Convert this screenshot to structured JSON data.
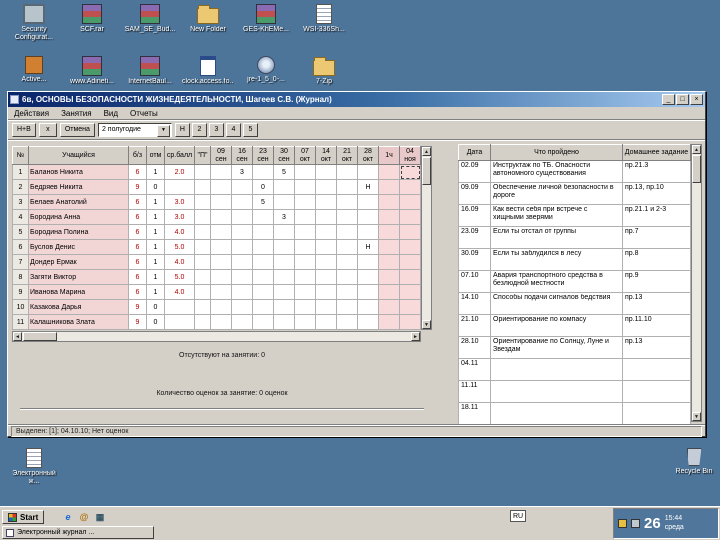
{
  "desktop": {
    "bg_color": "#4d7499",
    "icons_row1": [
      {
        "label": "Security Configurat...",
        "type": "app"
      },
      {
        "label": "SCF.rar",
        "type": "rar"
      },
      {
        "label": "SAM_SE_Bud...",
        "type": "rar"
      },
      {
        "label": "New Folder",
        "type": "folder"
      },
      {
        "label": "GES-KhEMe...",
        "type": "rar"
      },
      {
        "label": "WSI-336Sh...",
        "type": "doc"
      }
    ],
    "icons_row2": [
      {
        "label": "Active...",
        "type": "app2"
      },
      {
        "label": "www.Adineti...",
        "type": "rar"
      },
      {
        "label": "InternetBaul...",
        "type": "rar"
      },
      {
        "label": "clock.access.fo...",
        "type": "doc2"
      },
      {
        "label": "jre-1_5_0-...",
        "type": "installer"
      },
      {
        "label": "7-Zip",
        "type": "folder"
      }
    ],
    "bottom_icons": [
      {
        "label": "Электронный ж...",
        "type": "doc"
      },
      {
        "label": "Recycle Bin",
        "type": "recycle"
      }
    ]
  },
  "window": {
    "title": "6в, ОСНОВЫ БЕЗОПАСНОСТИ ЖИЗНЕДЕЯТЕЛЬНОСТИ, Шагеев С.В. (Журнал)",
    "menu": [
      "Действия",
      "Занятия",
      "Вид",
      "Отчеты"
    ],
    "toolbar": {
      "nv_button": "Н+В",
      "x_button": "х",
      "cancel_button": "Отмена",
      "period_select": "2 полугодие",
      "grade_buttons": [
        "Н",
        "2",
        "3",
        "4",
        "5"
      ]
    },
    "journal": {
      "col_headers": [
        "№",
        "Учащийся",
        "б/з",
        "отм",
        "ср.балл",
        "\"П\""
      ],
      "date_columns": [
        {
          "top": "09",
          "bot": "сен"
        },
        {
          "top": "16",
          "bot": "сен"
        },
        {
          "top": "23",
          "bot": "сен"
        },
        {
          "top": "30",
          "bot": "сен"
        },
        {
          "top": "07",
          "bot": "окт"
        },
        {
          "top": "14",
          "bot": "окт"
        },
        {
          "top": "21",
          "bot": "окт"
        },
        {
          "top": "28",
          "bot": "окт"
        },
        {
          "top": "1ч",
          "bot": ""
        },
        {
          "top": "04",
          "bot": "ноя"
        }
      ],
      "students": [
        {
          "num": "1",
          "name": "Баланов Никита",
          "bz": "6",
          "otm": "1",
          "avg": "2.0",
          "grades": [
            "",
            "3",
            "",
            "5",
            "",
            "",
            "",
            "",
            "",
            ""
          ]
        },
        {
          "num": "2",
          "name": "Бедряев Никита",
          "bz": "9",
          "otm": "0",
          "avg": "",
          "grades": [
            "",
            "",
            "0",
            "",
            "",
            "",
            "",
            "Н",
            "",
            ""
          ]
        },
        {
          "num": "3",
          "name": "Белаев Анатолий",
          "bz": "6",
          "otm": "1",
          "avg": "3.0",
          "grades": [
            "",
            "",
            "5",
            "",
            "",
            "",
            "",
            "",
            "",
            ""
          ]
        },
        {
          "num": "4",
          "name": "Бородина Анна",
          "bz": "6",
          "otm": "1",
          "avg": "3.0",
          "grades": [
            "",
            "",
            "",
            "3",
            "",
            "",
            "",
            "",
            "",
            ""
          ]
        },
        {
          "num": "5",
          "name": "Бородина Полина",
          "bz": "6",
          "otm": "1",
          "avg": "4.0",
          "grades": [
            "",
            "",
            "",
            "",
            "",
            "",
            "",
            "",
            "",
            ""
          ]
        },
        {
          "num": "6",
          "name": "Буслов Денис",
          "bz": "6",
          "otm": "1",
          "avg": "5.0",
          "grades": [
            "",
            "",
            "",
            "",
            "",
            "",
            "",
            "Н",
            "",
            ""
          ]
        },
        {
          "num": "7",
          "name": "Дондер Ермак",
          "bz": "6",
          "otm": "1",
          "avg": "4.0",
          "grades": [
            "",
            "",
            "",
            "",
            "",
            "",
            "",
            "",
            "",
            ""
          ]
        },
        {
          "num": "8",
          "name": "Загяти Виктор",
          "bz": "6",
          "otm": "1",
          "avg": "5.0",
          "grades": [
            "",
            "",
            "",
            "",
            "",
            "",
            "",
            "",
            "",
            ""
          ]
        },
        {
          "num": "9",
          "name": "Иванова Марина",
          "bz": "6",
          "otm": "1",
          "avg": "4.0",
          "grades": [
            "",
            "",
            "",
            "",
            "",
            "",
            "",
            "",
            "",
            ""
          ]
        },
        {
          "num": "10",
          "name": "Казакова Дарья",
          "bz": "9",
          "otm": "0",
          "avg": "",
          "grades": [
            "",
            "",
            "",
            "",
            "",
            "",
            "",
            "",
            "",
            ""
          ]
        },
        {
          "num": "11",
          "name": "Калашникова Злата",
          "bz": "9",
          "otm": "0",
          "avg": "",
          "grades": [
            "",
            "",
            "",
            "",
            "",
            "",
            "",
            "",
            "",
            ""
          ]
        }
      ],
      "selected": {
        "row": 0,
        "col": 9
      }
    },
    "summary": {
      "absent_line": "Отсутствуют на занятии: 0",
      "grades_line": "Количество оценок за занятие: 0 оценок"
    },
    "status_bar": "Выделен: [1]; 04.10.10; Нет оценок",
    "lessons": {
      "headers": [
        "Дата",
        "Что пройдено",
        "Домашнее задание"
      ],
      "rows": [
        {
          "date": "02.09",
          "topic": "Инструктаж по ТБ. Опасности автономного существования",
          "homework": "пр.21.3"
        },
        {
          "date": "09.09",
          "topic": "Обеспечение личной безопасности в дороге",
          "homework": "пр.13, пр.10"
        },
        {
          "date": "16.09",
          "topic": "Как вести себя при встрече с хищными зверями",
          "homework": "пр.21.1 и 2-3"
        },
        {
          "date": "23.09",
          "topic": "Если ты отстал от группы",
          "homework": "пр.7"
        },
        {
          "date": "30.09",
          "topic": "Если ты заблудился в лесу",
          "homework": "пр.8"
        },
        {
          "date": "07.10",
          "topic": "Авария транспортного средства в безлюдной местности",
          "homework": "пр.9"
        },
        {
          "date": "14.10",
          "topic": "Способы подачи сигналов бедствия",
          "homework": "пр.13"
        },
        {
          "date": "21.10",
          "topic": "Ориентирование по компасу",
          "homework": "пр.11.10"
        },
        {
          "date": "28.10",
          "topic": "Ориентирование по Солнцу, Луне и Звездам",
          "homework": "пр.13"
        },
        {
          "date": "04.11",
          "topic": "",
          "homework": ""
        },
        {
          "date": "11.11",
          "topic": "",
          "homework": ""
        },
        {
          "date": "18.11",
          "topic": "",
          "homework": ""
        }
      ]
    }
  },
  "taskbar": {
    "start_label": "Start",
    "quick_launch": [
      {
        "glyph": "e",
        "name": "internet-explorer-icon"
      },
      {
        "glyph": "@",
        "name": "mail-icon"
      },
      {
        "glyph": "▦",
        "name": "show-desktop-icon"
      }
    ],
    "language": "RU",
    "task_button": "Электронный журнал ...",
    "tray": {
      "day": "26",
      "time": "15:44",
      "weekday": "среда"
    }
  }
}
